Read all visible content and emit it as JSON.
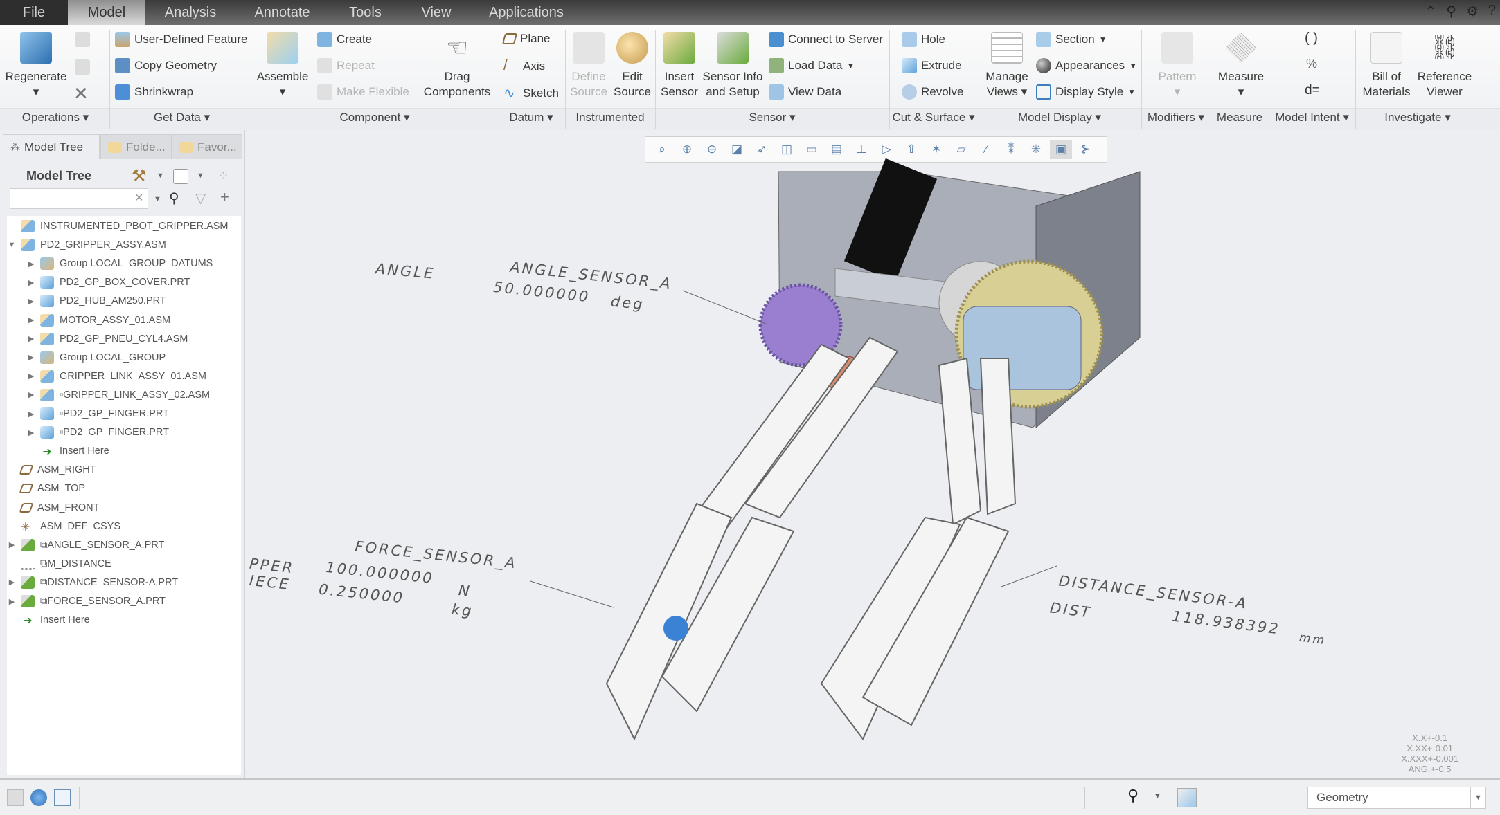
{
  "menu_tabs": [
    {
      "label": "File"
    },
    {
      "label": "Model",
      "active": true
    },
    {
      "label": "Analysis"
    },
    {
      "label": "Annotate"
    },
    {
      "label": "Tools"
    },
    {
      "label": "View"
    },
    {
      "label": "Applications"
    }
  ],
  "window_icons": [
    "collapse-ribbon-icon",
    "search-icon",
    "settings-icon",
    "help-icon"
  ],
  "ribbon": {
    "groups": {
      "operations": "Operations ▾",
      "get_data": "Get Data ▾",
      "component": "Component ▾",
      "datum": "Datum ▾",
      "instrumented": "Instrumented",
      "sensor": "Sensor ▾",
      "cut_surface": "Cut & Surface ▾",
      "model_display": "Model Display ▾",
      "modifiers": "Modifiers ▾",
      "measure": "Measure",
      "model_intent": "Model Intent ▾",
      "investigate": "Investigate ▾"
    },
    "regenerate": "Regenerate",
    "user_defined_feature": "User-Defined Feature",
    "copy_geometry": "Copy Geometry",
    "shrinkwrap": "Shrinkwrap",
    "assemble": "Assemble",
    "create": "Create",
    "repeat": "Repeat",
    "make_flexible": "Make Flexible",
    "drag_components_1": "Drag",
    "drag_components_2": "Components",
    "plane": "Plane",
    "axis": "Axis",
    "sketch": "Sketch",
    "define_source_1": "Define",
    "define_source_2": "Source",
    "edit_source_1": "Edit",
    "edit_source_2": "Source",
    "insert_sensor_1": "Insert",
    "insert_sensor_2": "Sensor",
    "sensor_info_1": "Sensor Info",
    "sensor_info_2": "and Setup",
    "connect_to_server": "Connect to Server",
    "load_data": "Load Data",
    "view_data": "View Data",
    "hole": "Hole",
    "extrude": "Extrude",
    "revolve": "Revolve",
    "manage_views_1": "Manage",
    "manage_views_2": "Views ▾",
    "section": "Section",
    "appearances": "Appearances",
    "display_style": "Display Style",
    "pattern": "Pattern",
    "measure": "Measure",
    "bill_of_materials_1": "Bill of",
    "bill_of_materials_2": "Materials",
    "reference_viewer_1": "Reference",
    "reference_viewer_2": "Viewer"
  },
  "panel": {
    "tabs": [
      {
        "label": "Model Tree",
        "active": true
      },
      {
        "label": "Folde..."
      },
      {
        "label": "Favor..."
      }
    ],
    "title": "Model Tree",
    "search_value": "",
    "tree": [
      {
        "label": "INSTRUMENTED_PBOT_GRIPPER.ASM",
        "level": 0,
        "toggle": "",
        "icon": "assembly"
      },
      {
        "label": "PD2_GRIPPER_ASSY.ASM",
        "level": 0,
        "toggle": "▼",
        "icon": "assembly"
      },
      {
        "label": "Group LOCAL_GROUP_DATUMS",
        "level": 1,
        "toggle": "▶",
        "icon": "group"
      },
      {
        "label": "PD2_GP_BOX_COVER.PRT",
        "level": 1,
        "toggle": "▶",
        "icon": "part"
      },
      {
        "label": "PD2_HUB_AM250.PRT",
        "level": 1,
        "toggle": "▶",
        "icon": "part"
      },
      {
        "label": "MOTOR_ASSY_01.ASM",
        "level": 1,
        "toggle": "▶",
        "icon": "assembly"
      },
      {
        "label": "PD2_GP_PNEU_CYL4.ASM",
        "level": 1,
        "toggle": "▶",
        "icon": "assembly"
      },
      {
        "label": "Group LOCAL_GROUP",
        "level": 1,
        "toggle": "▶",
        "icon": "group"
      },
      {
        "label": "GRIPPER_LINK_ASSY_01.ASM",
        "level": 1,
        "toggle": "▶",
        "icon": "assembly"
      },
      {
        "label": "▫GRIPPER_LINK_ASSY_02.ASM",
        "level": 1,
        "toggle": "▶",
        "icon": "assembly"
      },
      {
        "label": "▫PD2_GP_FINGER.PRT",
        "level": 1,
        "toggle": "▶",
        "icon": "part"
      },
      {
        "label": "▫PD2_GP_FINGER.PRT",
        "level": 1,
        "toggle": "▶",
        "icon": "part"
      },
      {
        "label": "Insert Here",
        "level": 1,
        "toggle": "",
        "icon": "insert"
      },
      {
        "label": "ASM_RIGHT",
        "level": 0,
        "toggle": "",
        "icon": "plane"
      },
      {
        "label": "ASM_TOP",
        "level": 0,
        "toggle": "",
        "icon": "plane"
      },
      {
        "label": "ASM_FRONT",
        "level": 0,
        "toggle": "",
        "icon": "plane"
      },
      {
        "label": "ASM_DEF_CSYS",
        "level": 0,
        "toggle": "",
        "icon": "csys"
      },
      {
        "label": "⧉ANGLE_SENSOR_A.PRT",
        "level": 0,
        "toggle": "▶",
        "icon": "sensor"
      },
      {
        "label": "⧉M_DISTANCE",
        "level": 0,
        "toggle": "",
        "icon": "measure"
      },
      {
        "label": "⧉DISTANCE_SENSOR-A.PRT",
        "level": 0,
        "toggle": "▶",
        "icon": "sensor"
      },
      {
        "label": "⧉FORCE_SENSOR_A.PRT",
        "level": 0,
        "toggle": "▶",
        "icon": "sensor"
      },
      {
        "label": "Insert Here",
        "level": 0,
        "toggle": "",
        "icon": "insert"
      }
    ]
  },
  "viewport": {
    "toolbar": [
      "zoom-fit",
      "zoom-in",
      "zoom-out",
      "repaint",
      "view-orientation",
      "display-style",
      "saved-views",
      "view-manager",
      "perspective",
      "spin-center",
      "annotation-display",
      "datum-display",
      "plane-display",
      "axis-display",
      "point-display",
      "csys-display",
      "annotation-toggle",
      "sensor-display"
    ],
    "annotations": {
      "angle_label": "ANGLE",
      "angle_sensor_name": "ANGLE_SENSOR_A",
      "angle_sensor_value": "50.000000",
      "angle_sensor_unit": "deg",
      "force_left_1": "PPER",
      "force_left_2": "IECE",
      "force_sensor_name": "FORCE_SENSOR_A",
      "force_sensor_value": "100.000000",
      "force_sensor_unit": "N",
      "mass_value": "0.250000",
      "mass_unit": "kg",
      "distance_sensor_name": "DISTANCE_SENSOR-A",
      "distance_label": "DIST",
      "distance_value": "118.938392",
      "distance_unit": "mm"
    },
    "tolerances": [
      "X.X+-0.1",
      "X.XX+-0.01",
      "X.XXX+-0.001",
      "ANG.+-0.5"
    ]
  },
  "statusbar": {
    "selection_filter": "Geometry"
  }
}
